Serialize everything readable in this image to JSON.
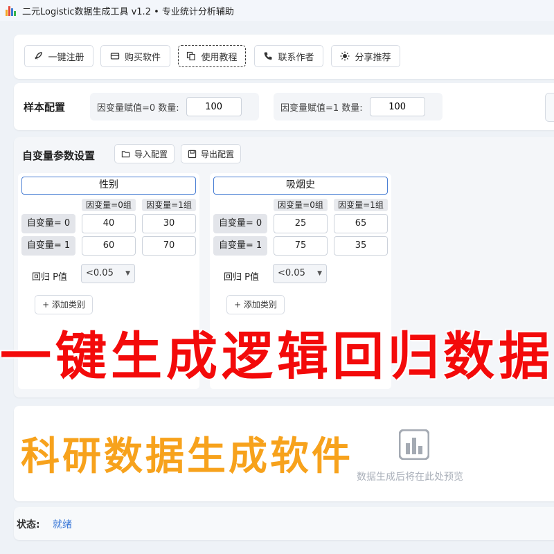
{
  "window": {
    "title": "二元Logistic数据生成工具 v1.2 • 专业统计分析辅助",
    "icon_colors": [
      "#3a7bd5",
      "#e64a3b",
      "#f5a623"
    ]
  },
  "toolbar": {
    "buttons": [
      {
        "label": "一键注册",
        "icon": "rocket-icon"
      },
      {
        "label": "购买软件",
        "icon": "credit-card-icon"
      },
      {
        "label": "使用教程",
        "icon": "copy-icon"
      },
      {
        "label": "联系作者",
        "icon": "phone-icon"
      },
      {
        "label": "分享推荐",
        "icon": "sun-icon"
      }
    ]
  },
  "sample": {
    "heading": "样本配置",
    "fields": [
      {
        "label": "因变量赋值=0 数量:",
        "value": "100"
      },
      {
        "label": "因变量赋值=1 数量:",
        "value": "100"
      }
    ]
  },
  "variables": {
    "heading": "自变量参数设置",
    "import_label": "导入配置",
    "export_label": "导出配置",
    "cards": [
      {
        "name": "性别",
        "col_headers": [
          "因变量=0组",
          "因变量=1组"
        ],
        "rows": [
          {
            "label": "自变量= 0",
            "values": [
              "40",
              "30"
            ]
          },
          {
            "label": "自变量= 1",
            "values": [
              "60",
              "70"
            ]
          }
        ],
        "p_label": "回归 P值",
        "p_value": "<0.05",
        "add_label": "+ 添加类别"
      },
      {
        "name": "吸烟史",
        "col_headers": [
          "因变量=0组",
          "因变量=1组"
        ],
        "rows": [
          {
            "label": "自变量= 0",
            "values": [
              "25",
              "65"
            ]
          },
          {
            "label": "自变量= 1",
            "values": [
              "75",
              "35"
            ]
          }
        ],
        "p_label": "回归 P值",
        "p_value": "<0.05",
        "add_label": "+ 添加类别"
      }
    ]
  },
  "preview": {
    "placeholder": "数据生成后将在此处预览",
    "icon": "bar-chart-icon"
  },
  "status": {
    "label": "状态:",
    "value": "就绪"
  },
  "overlay": {
    "headline": "一键生成逻辑回归数据",
    "subline": "科研数据生成软件",
    "headline_color": "#f30a0a",
    "subline_color": "#f7a21c"
  }
}
